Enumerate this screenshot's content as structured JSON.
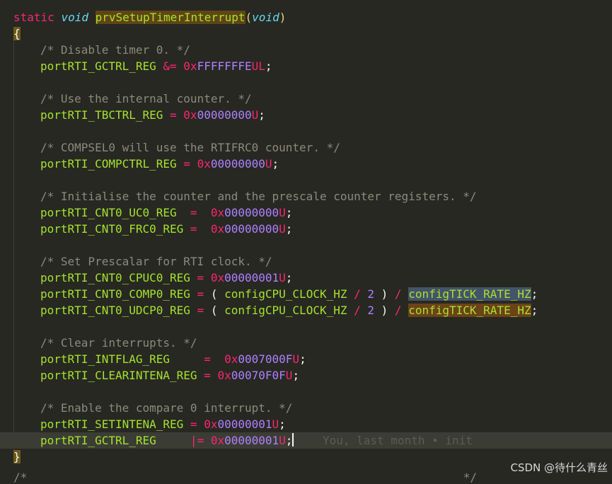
{
  "editor": {
    "language": "c",
    "lines": [
      {
        "kind": "signature",
        "kw": "static",
        "ty": "void",
        "fn": "prvSetupTimerInterrupt",
        "lp": "(",
        "param": "void",
        "rp": ")"
      },
      {
        "kind": "brace",
        "text": "{"
      },
      {
        "kind": "comment",
        "text": "/* Disable timer 0. */"
      },
      {
        "kind": "assign",
        "id": "portRTI_GCTRL_REG",
        "op": " &= ",
        "prefix": "0x",
        "num": "FFFFFFFE",
        "suffix": "UL",
        "end": ";"
      },
      {
        "kind": "blank"
      },
      {
        "kind": "comment",
        "text": "/* Use the internal counter. */"
      },
      {
        "kind": "assign",
        "id": "portRTI_TBCTRL_REG",
        "op": " = ",
        "prefix": "0x",
        "num": "00000000",
        "suffix": "U",
        "end": ";"
      },
      {
        "kind": "blank"
      },
      {
        "kind": "comment",
        "text": "/* COMPSEL0 will use the RTIFRC0 counter. */"
      },
      {
        "kind": "assign",
        "id": "portRTI_COMPCTRL_REG",
        "op": " = ",
        "prefix": "0x",
        "num": "00000000",
        "suffix": "U",
        "end": ";"
      },
      {
        "kind": "blank"
      },
      {
        "kind": "comment",
        "text": "/* Initialise the counter and the prescale counter registers. */"
      },
      {
        "kind": "assign",
        "id": "portRTI_CNT0_UC0_REG",
        "op": "  =  ",
        "prefix": "0x",
        "num": "00000000",
        "suffix": "U",
        "end": ";"
      },
      {
        "kind": "assign",
        "id": "portRTI_CNT0_FRC0_REG",
        "op": " =  ",
        "prefix": "0x",
        "num": "00000000",
        "suffix": "U",
        "end": ";"
      },
      {
        "kind": "blank"
      },
      {
        "kind": "comment",
        "text": "/* Set Prescalar for RTI clock. */"
      },
      {
        "kind": "assign",
        "id": "portRTI_CNT0_CPUC0_REG",
        "op": " = ",
        "prefix": "0x",
        "num": "00000001",
        "suffix": "U",
        "end": ";"
      },
      {
        "kind": "expr",
        "id": "portRTI_CNT0_COMP0_REG",
        "op": " = ",
        "lp": "( ",
        "macro1": "configCPU_CLOCK_HZ",
        "div1": " / ",
        "two": "2",
        "rp": " )",
        "div2": " / ",
        "macro2": "configTICK_RATE_HZ",
        "hl": "sel",
        "end": ";"
      },
      {
        "kind": "expr",
        "id": "portRTI_CNT0_UDCP0_REG",
        "op": " = ",
        "lp": "( ",
        "macro1": "configCPU_CLOCK_HZ",
        "div1": " / ",
        "two": "2",
        "rp": " )",
        "div2": " / ",
        "macro2": "configTICK_RATE_HZ",
        "hl": "match",
        "end": ";"
      },
      {
        "kind": "blank"
      },
      {
        "kind": "comment",
        "text": "/* Clear interrupts. */"
      },
      {
        "kind": "assign",
        "id": "portRTI_INTFLAG_REG",
        "op": "     =  ",
        "prefix": "0x",
        "num": "0007000F",
        "suffix": "U",
        "end": ";"
      },
      {
        "kind": "assign",
        "id": "portRTI_CLEARINTENA_REG",
        "op": " = ",
        "prefix": "0x",
        "num": "00070F0F",
        "suffix": "U",
        "end": ";"
      },
      {
        "kind": "blank"
      },
      {
        "kind": "comment",
        "text": "/* Enable the compare 0 interrupt. */"
      },
      {
        "kind": "assign",
        "id": "portRTI_SETINTENA_REG",
        "op": " = ",
        "prefix": "0x",
        "num": "00000001",
        "suffix": "U",
        "end": ";"
      },
      {
        "kind": "assign",
        "id": "portRTI_GCTRL_REG",
        "op": "     |= ",
        "prefix": "0x",
        "num": "00000001",
        "suffix": "U",
        "end": ";",
        "current": true,
        "blame": "You, last month • init"
      },
      {
        "kind": "brace",
        "text": "}"
      }
    ],
    "partial_line": "/*                                                                */"
  },
  "watermark": "CSDN @待什么青丝",
  "colors": {
    "background": "#272822",
    "keyword": "#f92672",
    "type": "#66d9ef",
    "function": "#a6e22e",
    "number": "#ae81ff",
    "comment": "#8b8a7c"
  }
}
